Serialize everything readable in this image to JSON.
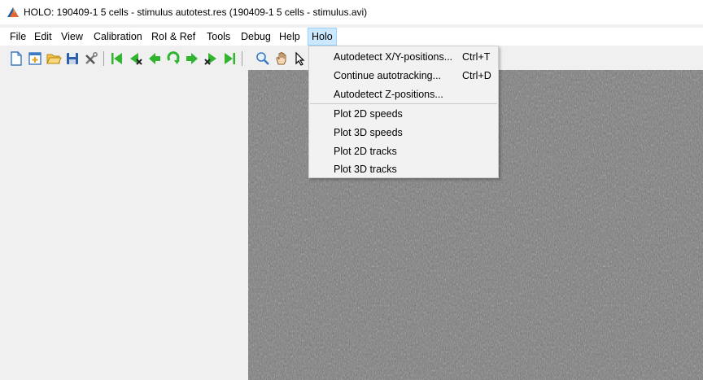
{
  "window": {
    "title": "HOLO: 190409-1 5 cells - stimulus autotest.res (190409-1 5 cells - stimulus.avi)",
    "icon": "matlab-icon"
  },
  "menubar": {
    "items": [
      {
        "label": "File"
      },
      {
        "label": "Edit"
      },
      {
        "label": "View"
      },
      {
        "label": "Calibration"
      },
      {
        "label": "RoI & Ref"
      },
      {
        "label": "Tools"
      },
      {
        "label": "Debug"
      },
      {
        "label": "Help"
      },
      {
        "label": "Holo",
        "active": true
      }
    ]
  },
  "toolbar": {
    "buttons": [
      {
        "icon": "new-file-icon"
      },
      {
        "icon": "new-window-icon"
      },
      {
        "icon": "open-folder-icon"
      },
      {
        "icon": "save-icon"
      },
      {
        "icon": "tools-icon"
      },
      {
        "icon": "go-first-icon"
      },
      {
        "icon": "step-back-delete-icon"
      },
      {
        "icon": "step-back-icon"
      },
      {
        "icon": "rotate-icon"
      },
      {
        "icon": "step-forward-icon"
      },
      {
        "icon": "step-forward-delete-icon"
      },
      {
        "icon": "go-last-icon"
      },
      {
        "icon": "zoom-icon"
      },
      {
        "icon": "pan-hand-icon"
      },
      {
        "icon": "pointer-icon"
      }
    ]
  },
  "holo_menu": {
    "items": [
      {
        "label": "Autodetect X/Y-positions...",
        "shortcut": "Ctrl+T"
      },
      {
        "label": "Continue autotracking...",
        "shortcut": "Ctrl+D"
      },
      {
        "label": "Autodetect Z-positions...",
        "shortcut": ""
      },
      {
        "label": "Plot 2D speeds",
        "shortcut": ""
      },
      {
        "label": "Plot 3D speeds",
        "shortcut": ""
      },
      {
        "label": "Plot 2D tracks",
        "shortcut": ""
      },
      {
        "label": "Plot 3D tracks",
        "shortcut": ""
      }
    ]
  },
  "colors": {
    "menu_highlight": "#cce8ff",
    "image_gray": "#7a7a7a",
    "arrow_green": "#2fb52f"
  }
}
